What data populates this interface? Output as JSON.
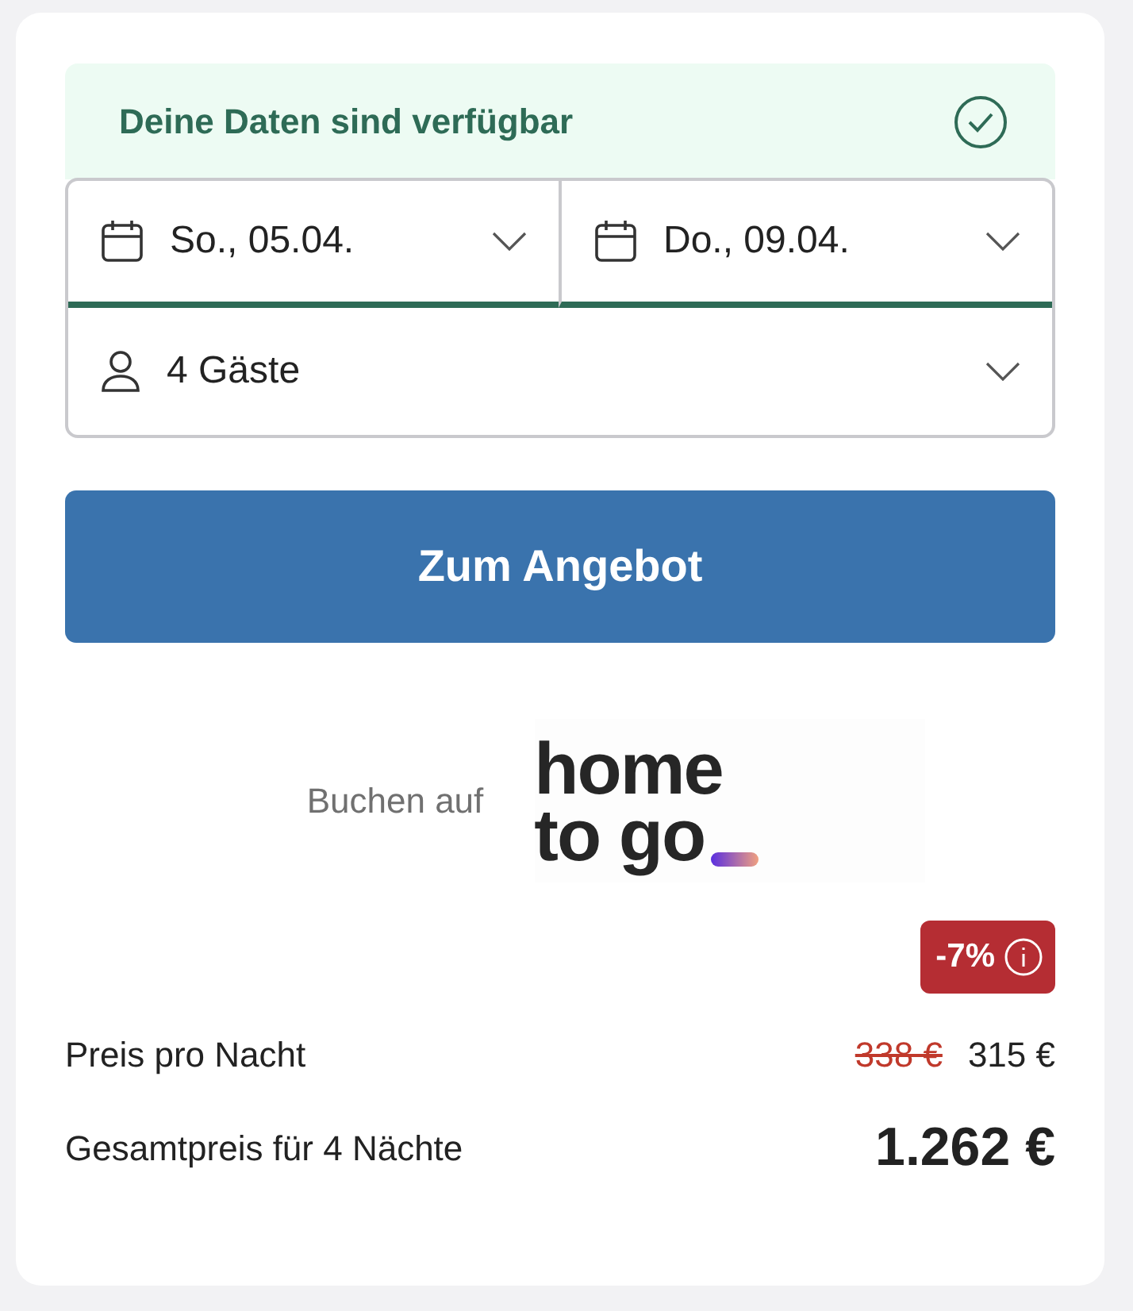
{
  "availability": {
    "text": "Deine Daten sind verfügbar",
    "available": true
  },
  "dates": [
    {
      "label": "So., 05.04.",
      "highlighted": true
    },
    {
      "label": "Do., 09.04.",
      "highlighted": true
    }
  ],
  "guests": {
    "label": "4 Gäste"
  },
  "cta": {
    "label": "Zum Angebot"
  },
  "provider": {
    "prefix": "Buchen auf",
    "logo_lines": [
      "home",
      "to go"
    ]
  },
  "discount": {
    "label": "-7%"
  },
  "prices": [
    {
      "kind": "per_night",
      "label": "Preis pro Nacht",
      "old": "338 €",
      "value": "315 €"
    },
    {
      "kind": "total",
      "label": "Gesamtpreis für 4 Nächte",
      "value": "1.262 €"
    }
  ]
}
